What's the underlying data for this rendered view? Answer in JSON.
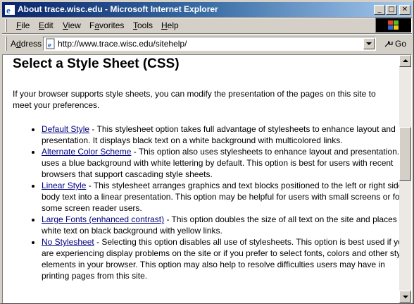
{
  "window": {
    "title": "About trace.wisc.edu - Microsoft Internet Explorer",
    "controls": {
      "minimize": "_",
      "maximize": "□",
      "close": "✕"
    }
  },
  "menubar": {
    "items": [
      {
        "label": "File",
        "accel": "F",
        "rest": "ile"
      },
      {
        "label": "Edit",
        "accel": "E",
        "rest": "dit"
      },
      {
        "label": "View",
        "accel": "V",
        "rest": "iew"
      },
      {
        "label": "Favorites",
        "accel": "a",
        "pre": "F",
        "rest": "vorites"
      },
      {
        "label": "Tools",
        "accel": "T",
        "rest": "ools"
      },
      {
        "label": "Help",
        "accel": "H",
        "rest": "elp"
      }
    ]
  },
  "addressbar": {
    "label_accel": "d",
    "label_pre": "A",
    "label_rest": "dress",
    "url": "http://www.trace.wisc.edu/sitehelp/",
    "go_label": "Go"
  },
  "page": {
    "heading": "Select a Style Sheet (CSS)",
    "intro": "If your browser supports style sheets, you can modify the presentation of the pages on this site to meet your preferences.",
    "options": [
      {
        "link": "Default Style",
        "desc": " - This stylesheet option takes full advantage of stylesheets to enhance layout and presentation. It displays black text on a white background with multicolored links."
      },
      {
        "link": "Alternate Color Scheme",
        "desc": " - This option also uses stylesheets to enhance layout and presentation. It uses a blue background with white lettering by default. This option is best for users with recent browsers that support cascading style sheets."
      },
      {
        "link": "Linear Style",
        "desc": " - This stylesheet arranges graphics and text blocks positioned to the left or right side of body text into a linear presentation. This option may be helpful for users with small screens or for some screen reader users."
      },
      {
        "link": "Large Fonts (enhanced contrast)",
        "desc": " - This option doubles the size of all text on the site and places white text on black background with yellow links."
      },
      {
        "link": "No Stylesheet",
        "desc": " - Selecting this option disables all use of stylesheets. This option is best used if you are experiencing display problems on the site or if you prefer to select fonts, colors and other style elements in your browser. This option may also help to resolve difficulties users may have in printing pages from this site."
      }
    ]
  }
}
